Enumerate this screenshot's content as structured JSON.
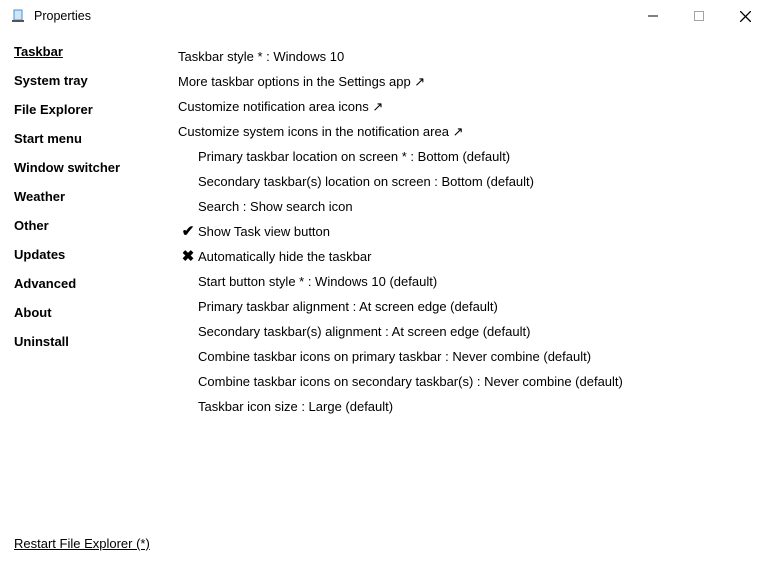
{
  "window": {
    "title": "Properties"
  },
  "sidebar": {
    "items": [
      "Taskbar",
      "System tray",
      "File Explorer",
      "Start menu",
      "Window switcher",
      "Weather",
      "Other",
      "Updates",
      "Advanced",
      "About",
      "Uninstall"
    ],
    "active_index": 0
  },
  "links": {
    "taskbar_style": "Taskbar style * : Windows 10",
    "more_options": "More taskbar options in the Settings app ↗",
    "customize_notif": "Customize notification area icons ↗",
    "customize_sys": "Customize system icons in the notification area ↗"
  },
  "settings": [
    {
      "key": "primary_location",
      "tick": "",
      "label": "Primary taskbar location on screen * : Bottom (default)"
    },
    {
      "key": "secondary_location",
      "tick": "",
      "label": "Secondary taskbar(s) location on screen : Bottom (default)"
    },
    {
      "key": "search",
      "tick": "",
      "label": "Search : Show search icon"
    },
    {
      "key": "task_view",
      "tick": "check",
      "label": "Show Task view button"
    },
    {
      "key": "auto_hide",
      "tick": "cross",
      "label": "Automatically hide the taskbar"
    },
    {
      "key": "start_style",
      "tick": "",
      "label": "Start button style * : Windows 10 (default)"
    },
    {
      "key": "primary_align",
      "tick": "",
      "label": "Primary taskbar alignment : At screen edge (default)"
    },
    {
      "key": "secondary_align",
      "tick": "",
      "label": "Secondary taskbar(s) alignment : At screen edge (default)"
    },
    {
      "key": "combine_primary",
      "tick": "",
      "label": "Combine taskbar icons on primary taskbar : Never combine (default)"
    },
    {
      "key": "combine_secondary",
      "tick": "",
      "label": "Combine taskbar icons on secondary taskbar(s) : Never combine (default)"
    },
    {
      "key": "icon_size",
      "tick": "",
      "label": "Taskbar icon size : Large (default)"
    }
  ],
  "footer": {
    "restart": "Restart File Explorer (*)"
  },
  "ticks": {
    "check": "✔",
    "cross": "✖"
  }
}
